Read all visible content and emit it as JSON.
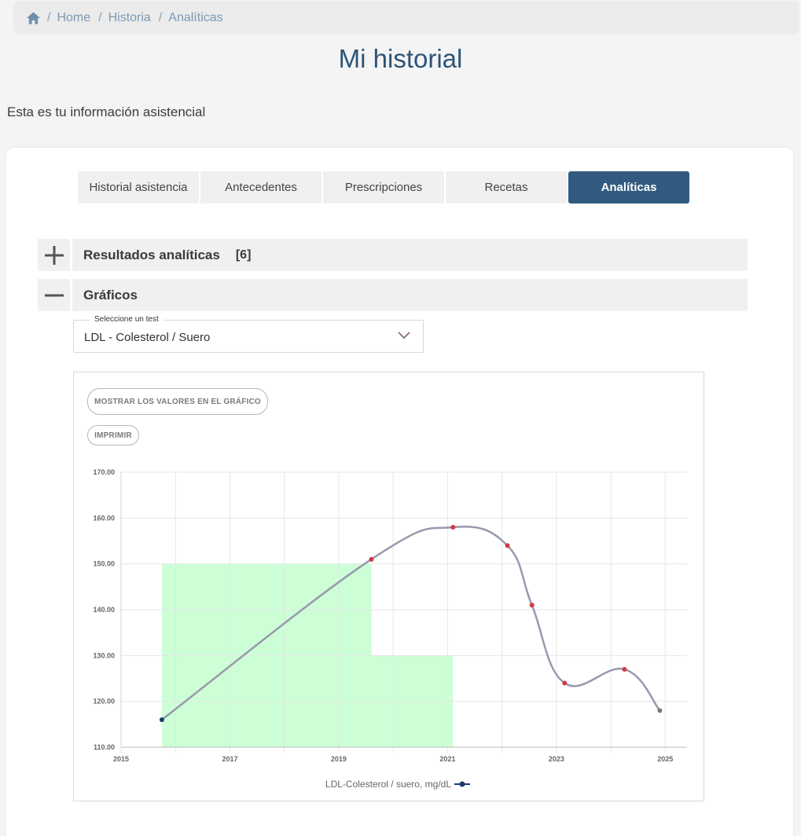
{
  "breadcrumb": {
    "home_icon": "home-icon",
    "items": [
      "Home",
      "Historia",
      "Analíticas"
    ]
  },
  "page": {
    "title": "Mi historial",
    "subtitle": "Esta es tu información asistencial"
  },
  "tabs": [
    {
      "label": "Historial asistencia",
      "active": false
    },
    {
      "label": "Antecedentes",
      "active": false
    },
    {
      "label": "Prescripciones",
      "active": false
    },
    {
      "label": "Recetas",
      "active": false
    },
    {
      "label": "Analíticas",
      "active": true
    }
  ],
  "accordion": {
    "results": {
      "label": "Resultados analíticas",
      "count": "[6]",
      "icon": "plus-icon",
      "expanded": false
    },
    "charts": {
      "label": "Gráficos",
      "icon": "minus-icon",
      "expanded": true
    }
  },
  "test_select": {
    "legend": "Seleccione un test",
    "value": "LDL - Colesterol / Suero"
  },
  "chart_buttons": {
    "show_values": "MOSTRAR LOS VALORES EN EL GRÁFICO",
    "print": "IMPRIMIR"
  },
  "colors": {
    "accent": "#325a80",
    "range_fill": "#ccffd6",
    "line": "#9a98ad",
    "point_out_of_range": "#d13a45",
    "point_first": "#1b3a6b",
    "point_last": "#7a7a7a"
  },
  "chart_data": {
    "type": "line",
    "series": [
      {
        "name": "LDL-Colesterol / suero, mg/dL",
        "x": [
          2015.75,
          2019.6,
          2021.1,
          2022.1,
          2022.55,
          2023.15,
          2024.25,
          2024.9
        ],
        "y": [
          116,
          151,
          158,
          154,
          141,
          124,
          127,
          118
        ]
      }
    ],
    "reference_ranges": [
      {
        "x": [
          2015.75,
          2019.6
        ],
        "y": [
          110,
          150
        ]
      },
      {
        "x": [
          2019.6,
          2021.1
        ],
        "y": [
          110,
          130
        ]
      }
    ],
    "xlim": [
      2015,
      2025.4
    ],
    "ylim": [
      110,
      170
    ],
    "x_ticks": [
      "2015",
      "2017",
      "2019",
      "2021",
      "2023",
      "2025"
    ],
    "y_ticks": [
      "110.00",
      "120.00",
      "130.00",
      "140.00",
      "150.00",
      "160.00",
      "170.00"
    ],
    "grid": true,
    "legend_position": "bottom"
  }
}
